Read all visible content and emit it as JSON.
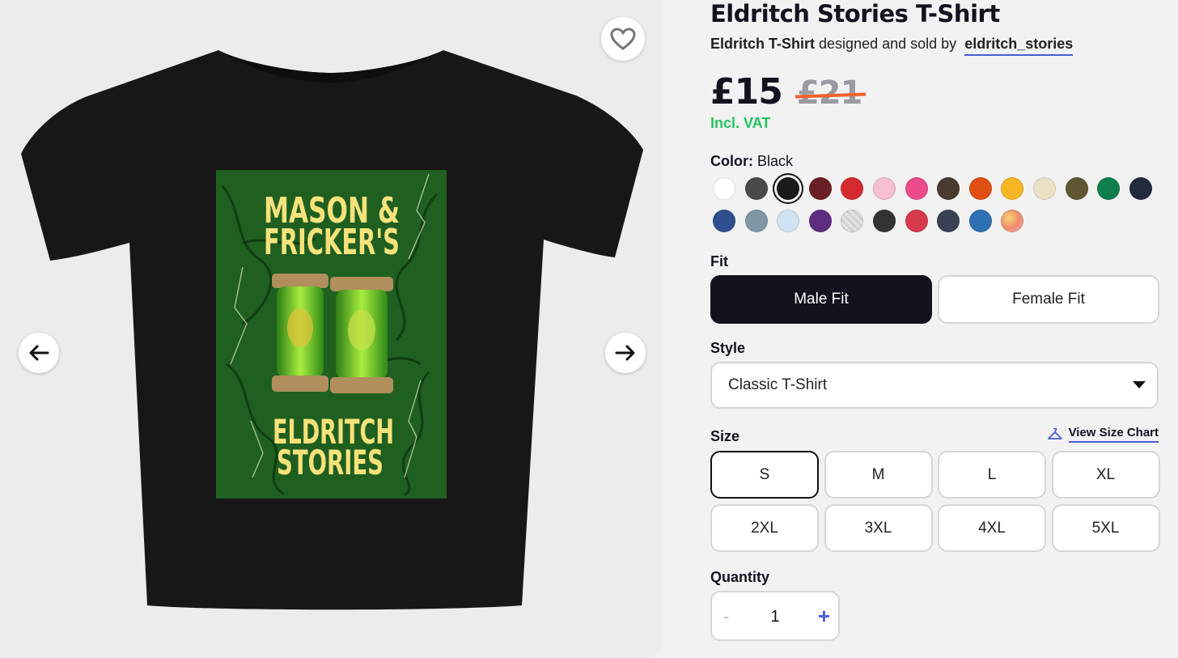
{
  "product": {
    "title": "Eldritch Stories T-Shirt",
    "product_name": "Eldritch T-Shirt",
    "byline_middle": "designed and sold by",
    "artist": "eldritch_stories",
    "price": "£15",
    "old_price": "£21",
    "vat_note": "Incl. VAT"
  },
  "gallery": {
    "favorite_icon": "heart-outline-icon",
    "prev_icon": "arrow-left-icon",
    "next_icon": "arrow-right-icon",
    "artwork": {
      "line1": "MASON &",
      "line2": "FRICKER'S",
      "line3": "ELDRITCH",
      "line4": "STORIES"
    }
  },
  "color": {
    "label": "Color:",
    "selected": "Black",
    "swatches": [
      "#ffffff",
      "#4a4a4a",
      "#1a1a1a",
      "#6b1f24",
      "#d42a2f",
      "#f7bfcf",
      "#ec4d8a",
      "#4b3a2f",
      "#e14f12",
      "#f8b623",
      "#ece1c6",
      "#5f5732",
      "#0e7f4c",
      "#232b3e",
      "#2f4f8f",
      "#7f97a5",
      "#cfe3f3",
      "#5e2d82",
      "#dcdcdc",
      "#333333",
      "#d63a4b",
      "#3a4155",
      "#2f6fb3",
      "#f3b86c"
    ]
  },
  "fit": {
    "label": "Fit",
    "male": "Male Fit",
    "female": "Female Fit"
  },
  "style": {
    "label": "Style",
    "value": "Classic T-Shirt"
  },
  "size": {
    "label": "Size",
    "chart_link": "View Size Chart",
    "chart_icon": "hanger-icon",
    "options": [
      "S",
      "M",
      "L",
      "XL",
      "2XL",
      "3XL",
      "4XL",
      "5XL"
    ],
    "selected": "S"
  },
  "quantity": {
    "label": "Quantity",
    "minus": "-",
    "value": "1",
    "plus": "+"
  }
}
